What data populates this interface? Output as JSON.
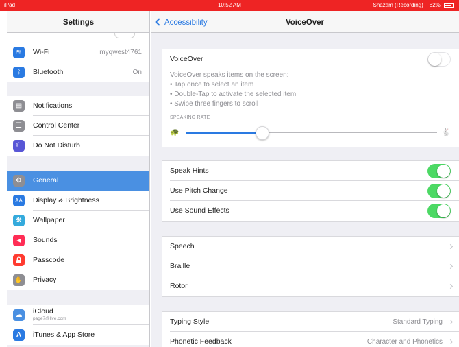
{
  "status_bar": {
    "device": "iPad",
    "time": "10:52 AM",
    "recording": "Shazam (Recording)",
    "battery": "82%"
  },
  "settings_panel": {
    "title": "Settings",
    "items": [
      {
        "label": "Wi-Fi",
        "value": "myqwest4761",
        "icon": "wifi-icon",
        "icon_glyph": "≋",
        "color": "#2a7ae2"
      },
      {
        "label": "Bluetooth",
        "value": "On",
        "icon": "bluetooth-icon",
        "icon_glyph": "ᛒ",
        "color": "#2a7ae2"
      },
      {
        "label": "Notifications",
        "icon": "notifications-icon",
        "icon_glyph": "▤",
        "color": "#8e8e93"
      },
      {
        "label": "Control Center",
        "icon": "control-center-icon",
        "icon_glyph": "☰",
        "color": "#8e8e93"
      },
      {
        "label": "Do Not Disturb",
        "icon": "moon-icon",
        "icon_glyph": "☾",
        "color": "#5856d6"
      },
      {
        "label": "General",
        "icon": "gear-icon",
        "icon_glyph": "⚙",
        "color": "#8e8e93",
        "selected": true
      },
      {
        "label": "Display & Brightness",
        "icon": "display-brightness-icon",
        "icon_glyph": "AA",
        "color": "#2a7ae2"
      },
      {
        "label": "Wallpaper",
        "icon": "wallpaper-icon",
        "icon_glyph": "❋",
        "color": "#34aadc"
      },
      {
        "label": "Sounds",
        "icon": "speaker-icon",
        "icon_glyph": "◀",
        "color": "#ff2d55"
      },
      {
        "label": "Passcode",
        "icon": "lock-icon",
        "icon_glyph": "🔒",
        "color": "#ff3b30"
      },
      {
        "label": "Privacy",
        "icon": "hand-icon",
        "icon_glyph": "✋",
        "color": "#8e8e93"
      },
      {
        "label": "iCloud",
        "sublabel": "page7@live.com",
        "icon": "icloud-icon",
        "icon_glyph": "☁",
        "color": "#4a90e2"
      },
      {
        "label": "iTunes & App Store",
        "icon": "app-store-icon",
        "icon_glyph": "A",
        "color": "#2a7ae2"
      }
    ]
  },
  "detail_panel": {
    "back_label": "Accessibility",
    "title": "VoiceOver",
    "voiceover": {
      "label": "VoiceOver",
      "enabled": false,
      "description": "VoiceOver speaks items on the screen:",
      "tips": [
        "• Tap once to select an item",
        "• Double-Tap to activate the selected item",
        "• Swipe three fingers to scroll"
      ],
      "speaking_rate_label": "SPEAKING RATE",
      "speaking_rate_fraction": 0.3
    },
    "toggles": [
      {
        "label": "Speak Hints",
        "enabled": true
      },
      {
        "label": "Use Pitch Change",
        "enabled": true
      },
      {
        "label": "Use Sound Effects",
        "enabled": true
      }
    ],
    "links": [
      {
        "label": "Speech"
      },
      {
        "label": "Braille"
      },
      {
        "label": "Rotor"
      }
    ],
    "options": [
      {
        "label": "Typing Style",
        "value": "Standard Typing"
      },
      {
        "label": "Phonetic Feedback",
        "value": "Character and Phonetics"
      }
    ]
  },
  "colors": {
    "status_bar": "#ee2424",
    "accent": "#2a7ae2",
    "toggle_on": "#4cd964",
    "selected_row": "#4a90e2"
  }
}
